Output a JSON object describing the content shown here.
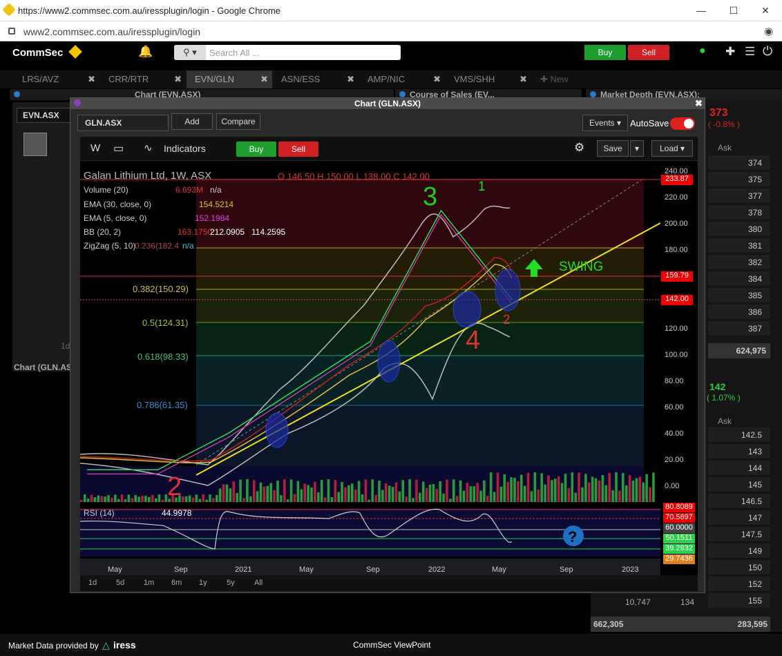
{
  "browser": {
    "title": "https://www2.commsec.com.au/iressplugin/login - Google Chrome",
    "url": "www2.commsec.com.au/iressplugin/login"
  },
  "app": {
    "brand": "CommSec",
    "search_placeholder": "Search All ...",
    "buy": "Buy",
    "sell": "Sell"
  },
  "tabs": [
    {
      "label": "LRS/AVZ"
    },
    {
      "label": "CRR/RTR"
    },
    {
      "label": "EVN/GLN"
    },
    {
      "label": "ASN/ESS"
    },
    {
      "label": "AMP/NIC"
    },
    {
      "label": "VMS/SHH"
    },
    {
      "label": "New"
    }
  ],
  "panels": {
    "left": "Chart (EVN.ASX)",
    "middle": "Course of Sales (EV...",
    "right": "Market Depth (EVN.ASX):"
  },
  "left_panel": {
    "symbol": "EVN.ASX",
    "footer": "Chart (GLN.ASX)",
    "one_d": "1d"
  },
  "depth": {
    "price_top": "373",
    "change_top": "( -0.8% )",
    "ask_header": "Ask",
    "asks_top": [
      "374",
      "375",
      "377",
      "378",
      "380",
      "381",
      "382",
      "384",
      "385",
      "386",
      "387"
    ],
    "total_top": "624,975",
    "price_bottom": "142",
    "change_bottom": "( 1.07% )",
    "asks_bottom": [
      "142.5",
      "143",
      "144",
      "145",
      "146.5",
      "147",
      "147.5",
      "149",
      "150",
      "152",
      "155"
    ],
    "row_bid": "10,747",
    "row_bid2": "134",
    "totals_bottom_left": "662,305",
    "totals_bottom_right": "283,595"
  },
  "modal": {
    "title": "Chart (GLN.ASX)",
    "symbol": "GLN.ASX",
    "add": "Add",
    "compare": "Compare",
    "events": "Events",
    "autosave": "AutoSave",
    "interval": "W",
    "indicators": "Indicators",
    "save": "Save",
    "load": "Load"
  },
  "legend": {
    "name": "Galan Lithium Ltd, 1W, ASX",
    "ohlc": "O 146.50  H 150.00  L 138.00  C 142.00",
    "volume": "Volume (20)",
    "volume_val": "6.693M",
    "volume_na": "n/a",
    "ema30": "EMA (30, close, 0)",
    "ema30_val": "154.5214",
    "ema5": "EMA (5, close, 0)",
    "ema5_val": "152.1984",
    "bb": "BB (20, 2)",
    "bb_vals": [
      "163.1750",
      "212.0905",
      "114.2595"
    ],
    "zigzag": "ZigZag (5, 10)",
    "zigzag_val": "n/a",
    "rsi": "RSI (14)",
    "rsi_val": "44.9978"
  },
  "price_axis": [
    "240.00",
    "220.00",
    "200.00",
    "180.00",
    "160.00",
    "140.00",
    "120.00",
    "100.00",
    "80.00",
    "60.00",
    "40.00",
    "20.00",
    "0.00"
  ],
  "price_tags": {
    "high": "233.87",
    "level": "159.79",
    "last": "142.00"
  },
  "rsi_axis": [
    "80.8089",
    "70.5897",
    "60.0000",
    "50.1511",
    "39.2932",
    "29.7436"
  ],
  "fib": [
    "0.382(150.29)",
    "0.5(124.31)",
    "0.618(98.33)",
    "0.786(61.35)",
    "0.236(182.4"
  ],
  "time_axis": [
    "May",
    "Sep",
    "2021",
    "May",
    "Sep",
    "2022",
    "May",
    "Sep",
    "2023"
  ],
  "ranges": [
    "1d",
    "5d",
    "1m",
    "6m",
    "1y",
    "5y",
    "All"
  ],
  "annotations": {
    "swing": "SWING",
    "wave1": "1",
    "wave2a": "2",
    "wave2b": "2",
    "wave3": "3",
    "wave4": "4"
  },
  "footer": {
    "provider": "Market Data provided by",
    "iress": "iress",
    "viewpoint": "CommSec ViewPoint"
  },
  "colors": {
    "buy": "#1e9e2e",
    "sell": "#d01f25",
    "accent": "#f5c400"
  },
  "chart_data": {
    "type": "line",
    "title": "Galan Lithium Ltd, 1W, ASX",
    "x": [
      "2020-05",
      "2020-09",
      "2021-01",
      "2021-05",
      "2021-09",
      "2022-01",
      "2022-05"
    ],
    "series": [
      {
        "name": "Galan Lithium Ltd",
        "values": [
          12,
          12,
          40,
          75,
          110,
          210,
          142
        ]
      }
    ],
    "ylim": [
      0,
      240
    ],
    "xlabel": "",
    "ylabel": ""
  }
}
